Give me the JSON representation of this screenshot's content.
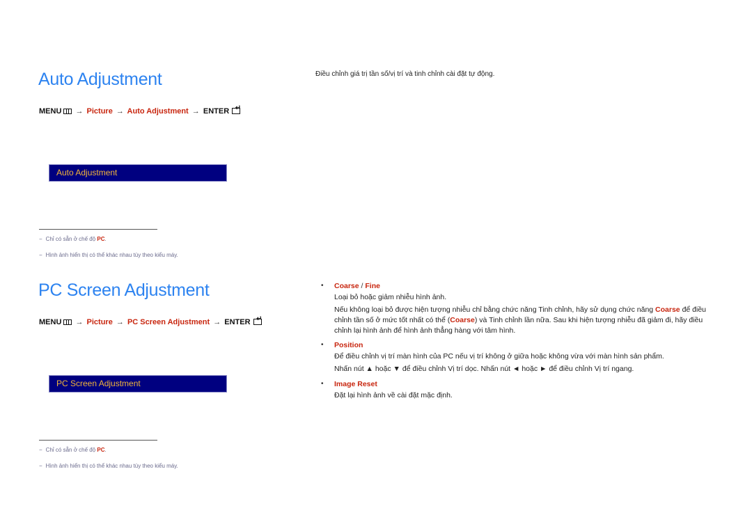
{
  "colors": {
    "heading": "#2d83f0",
    "accent_red": "#c8260f",
    "osd_background": "#000080",
    "osd_text": "#f2b43a"
  },
  "auto_adjustment": {
    "title": "Auto Adjustment",
    "description": "Điều chỉnh giá trị tần số/vị trí và tinh chỉnh cài đặt tự động.",
    "path": {
      "menu": "MENU",
      "menu_icon": "menu-grid-icon",
      "arrow": "→",
      "picture": "Picture",
      "item": "Auto Adjustment",
      "enter": "ENTER",
      "enter_icon": "enter-icon"
    },
    "osd_label": "Auto Adjustment",
    "notes": [
      {
        "dash": "−",
        "text": "Chỉ có sẵn ở chế độ ",
        "highlight": "PC",
        "suffix": "."
      },
      {
        "dash": "−",
        "text": "Hình ảnh hiển thị có thể khác nhau tùy theo kiểu máy."
      }
    ]
  },
  "pc_screen_adjustment": {
    "title": "PC Screen Adjustment",
    "path": {
      "menu": "MENU",
      "menu_icon": "menu-grid-icon",
      "arrow": "→",
      "picture": "Picture",
      "item": "PC Screen Adjustment",
      "enter": "ENTER",
      "enter_icon": "enter-icon"
    },
    "osd_label": "PC Screen Adjustment",
    "notes": [
      {
        "dash": "−",
        "text": "Chỉ có sẵn ở chế độ ",
        "highlight": "PC",
        "suffix": "."
      },
      {
        "dash": "−",
        "text": "Hình ảnh hiển thị có thể khác nhau tùy theo kiểu máy."
      }
    ],
    "bullets": [
      {
        "dot": "•",
        "title_a": "Coarse",
        "separator": " / ",
        "title_b": "Fine",
        "line1": "Loại bỏ hoặc giảm nhiễu hình ảnh.",
        "para_a": "Nếu không loại bỏ được hiện tượng nhiễu chỉ bằng chức năng Tinh chỉnh, hãy sử dụng chức năng ",
        "para_hl1": "Coarse",
        "para_b": " để điều chỉnh tần số ở mức tốt nhất có thể (",
        "para_hl2": "Coarse",
        "para_c": ") và Tinh chỉnh lần nữa. Sau khi hiện tượng nhiễu đã giảm đi, hãy điều chỉnh lại hình ảnh để hình ảnh thẳng hàng với tâm hình."
      },
      {
        "dot": "•",
        "title": "Position",
        "line1": "Để điều chỉnh vị trí màn hình của PC nếu vị trí không ở giữa hoặc không vừa với màn hình sản phẩm.",
        "line2": "Nhấn nút ▲ hoặc ▼ để điều chỉnh Vị trí dọc. Nhấn nút ◄ hoặc ► để điều chỉnh Vị trí ngang."
      },
      {
        "dot": "•",
        "title": "Image Reset",
        "line1": "Đặt lại hình ảnh về cài đặt mặc định."
      }
    ]
  }
}
